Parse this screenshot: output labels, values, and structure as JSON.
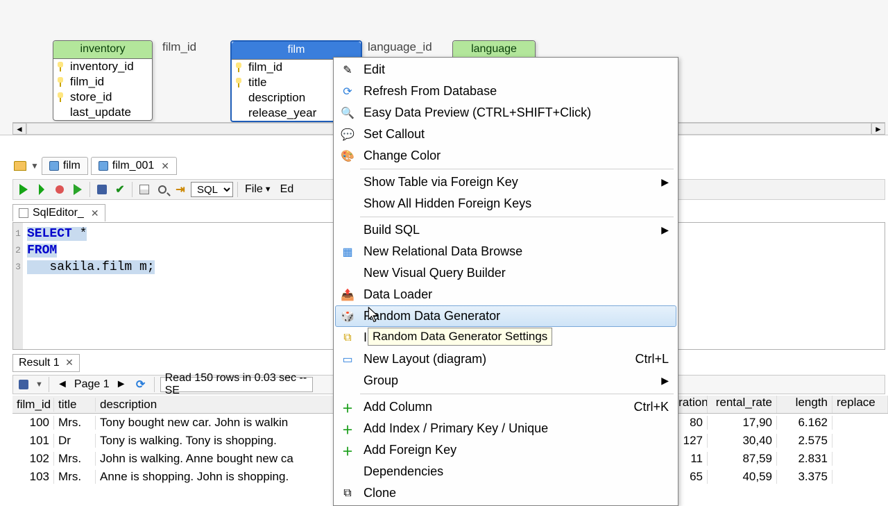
{
  "diagram": {
    "tables": {
      "inventory": {
        "title": "inventory",
        "cols": [
          "inventory_id",
          "film_id",
          "store_id",
          "last_update"
        ]
      },
      "film": {
        "title": "film",
        "cols": [
          "film_id",
          "title",
          "description",
          "release_year"
        ]
      },
      "language": {
        "title": "language"
      }
    },
    "links": {
      "inv_film": "film_id",
      "film_lang": "language_id"
    }
  },
  "file_tabs": {
    "t1": "film",
    "t2": "film_001"
  },
  "toolbar": {
    "sql_mode": "SQL",
    "menu_file": "File",
    "menu_edit": "Ed"
  },
  "editor_tab": "SqlEditor_",
  "sql": {
    "l1a": "SELECT",
    "l1b": " *",
    "l2": "FROM",
    "l3": "   sakila.film m;"
  },
  "result": {
    "tab": "Result 1",
    "page_label": "Page 1",
    "status": "Read 150 rows in 0.03 sec -- SE",
    "headers": {
      "film_id": "film_id",
      "title": "title",
      "description": "description",
      "l_duration": "l_duration",
      "rental_rate": "rental_rate",
      "length": "length",
      "replace": "replace"
    },
    "rows": [
      {
        "film_id": "100",
        "title": "Mrs.",
        "description": "Tony bought new car. John is walkin",
        "l_duration": "80",
        "rental_rate": "17,90",
        "length": "6.162",
        "replace": ""
      },
      {
        "film_id": "101",
        "title": "Dr",
        "description": "Tony is walking. Tony is shopping.",
        "l_duration": "127",
        "rental_rate": "30,40",
        "length": "2.575",
        "replace": ""
      },
      {
        "film_id": "102",
        "title": "Mrs.",
        "description": "John is walking. Anne bought new ca",
        "l_duration": "11",
        "rental_rate": "87,59",
        "length": "2.831",
        "replace": ""
      },
      {
        "film_id": "103",
        "title": "Mrs.",
        "description": "Anne is shopping. John is shopping.",
        "l_duration": "65",
        "rental_rate": "40,59",
        "length": "3.375",
        "replace": ""
      }
    ]
  },
  "context_menu": {
    "edit": "Edit",
    "refresh": "Refresh From Database",
    "preview": "Easy Data Preview (CTRL+SHIFT+Click)",
    "callout": "Set Callout",
    "color": "Change Color",
    "show_fk": "Show Table via Foreign Key",
    "show_all_fk": "Show All Hidden Foreign Keys",
    "build_sql": "Build SQL",
    "rel_browse": "New Relational Data Browse",
    "vqb": "New Visual Query Builder",
    "loader": "Data Loader",
    "rdg": "Random Data Generator",
    "rdg_hidden": "I",
    "layout": "New Layout (diagram)",
    "layout_sc": "Ctrl+L",
    "group": "Group",
    "add_col": "Add Column",
    "add_col_sc": "Ctrl+K",
    "add_idx": "Add Index / Primary Key / Unique",
    "add_fk": "Add Foreign Key",
    "deps": "Dependencies",
    "clone": "Clone"
  },
  "tooltip": "Random Data Generator Settings"
}
